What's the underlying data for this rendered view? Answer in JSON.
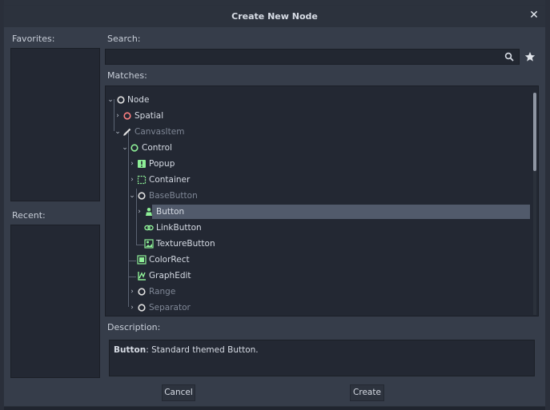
{
  "dialog": {
    "title": "Create New Node",
    "close_label": "✕"
  },
  "favorites_label": "Favorites:",
  "recent_label": "Recent:",
  "search": {
    "label": "Search:",
    "value": "",
    "placeholder": ""
  },
  "matches_label": "Matches:",
  "tree": [
    {
      "label": "Node",
      "icon": "node-circle-icon",
      "dim": false,
      "expanded": true
    },
    {
      "label": "Spatial",
      "icon": "spatial-circle-icon",
      "dim": false,
      "expanded": false
    },
    {
      "label": "CanvasItem",
      "icon": "pencil-icon",
      "dim": true,
      "expanded": true
    },
    {
      "label": "Control",
      "icon": "control-circle-icon",
      "dim": false,
      "expanded": true
    },
    {
      "label": "Popup",
      "icon": "popup-icon",
      "dim": false,
      "expanded": false
    },
    {
      "label": "Container",
      "icon": "container-icon",
      "dim": false,
      "expanded": false
    },
    {
      "label": "BaseButton",
      "icon": "basebutton-circle-icon",
      "dim": true,
      "expanded": true
    },
    {
      "label": "Button",
      "icon": "button-icon",
      "dim": false,
      "expanded": false,
      "selected": true
    },
    {
      "label": "LinkButton",
      "icon": "link-icon",
      "dim": false
    },
    {
      "label": "TextureButton",
      "icon": "texturebutton-icon",
      "dim": false
    },
    {
      "label": "ColorRect",
      "icon": "colorrect-icon",
      "dim": false
    },
    {
      "label": "GraphEdit",
      "icon": "graphedit-icon",
      "dim": false
    },
    {
      "label": "Range",
      "icon": "range-circle-icon",
      "dim": true,
      "expanded": false
    },
    {
      "label": "Separator",
      "icon": "separator-circle-icon",
      "dim": true,
      "expanded": false
    }
  ],
  "description": {
    "label": "Description:",
    "name": "Button",
    "text": ": Standard themed Button."
  },
  "buttons": {
    "cancel": "Cancel",
    "create": "Create"
  },
  "colors": {
    "accent_green": "#8eef97",
    "spatial_red": "#fc7f7f",
    "node_white": "#e0e0e0"
  }
}
